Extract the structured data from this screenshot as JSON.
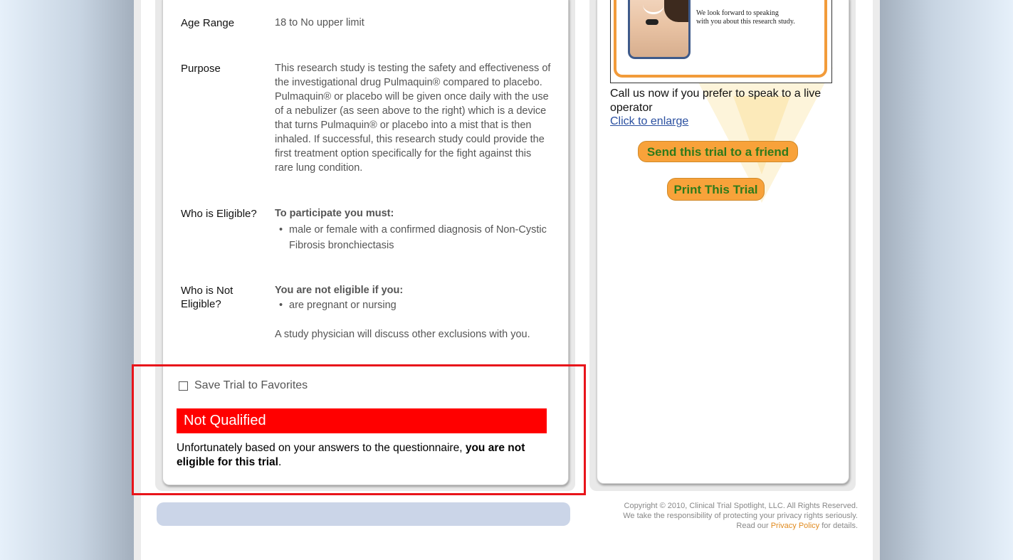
{
  "details": {
    "age": {
      "label": "Age Range",
      "value": "18 to No upper limit"
    },
    "purpose": {
      "label": "Purpose",
      "value": "This research study is testing the safety and effectiveness of the investigational drug Pulmaquin® compared to placebo. Pulmaquin® or placebo will be given once daily with the use of a nebulizer (as seen above to the right) which is a device that turns Pulmaquin® or placebo into a mist that is then inhaled. If successful, this research study could provide the first treatment option specifically for the fight against this rare lung condition."
    },
    "eligible": {
      "label": "Who is Eligible?",
      "heading": "To participate you must:",
      "items": [
        "male or female with a confirmed diagnosis of Non-Cystic Fibrosis bronchiectasis"
      ]
    },
    "not_eligible": {
      "label": "Who is Not Eligible?",
      "heading": "You are not eligible if you:",
      "items": [
        "are pregnant or nursing"
      ],
      "note": "A study physician will discuss other exclusions with you."
    }
  },
  "favorites": {
    "label": "Save Trial to Favorites"
  },
  "status": {
    "title": "Not Qualified",
    "message_prefix": "Unfortunately based on your answers to the questionnaire, ",
    "message_bold": "you are not eligible for this trial",
    "message_suffix": "."
  },
  "sidebar": {
    "ad_text_line1": "We look forward to speaking",
    "ad_text_line2": "with you about this research study.",
    "call_text": "Call us now if you prefer to speak to a live operator",
    "enlarge_link": "Click to enlarge",
    "send_button": "Send this trial to a friend",
    "print_button": "Print This Trial"
  },
  "footer": {
    "copyright": "Copyright © 2010, Clinical Trial Spotlight, LLC. All Rights Reserved.",
    "privacy_line": "We take the responsibility of protecting your privacy rights seriously.",
    "read_our": "Read our",
    "privacy_link": "Privacy Policy",
    "for_details": "for details."
  },
  "colors": {
    "not_qualified_bg": "#ff0000",
    "button_bg": "#f8a23a",
    "button_text": "#2f7a1a",
    "highlight": "#e8141a",
    "link": "#2b50a0"
  }
}
